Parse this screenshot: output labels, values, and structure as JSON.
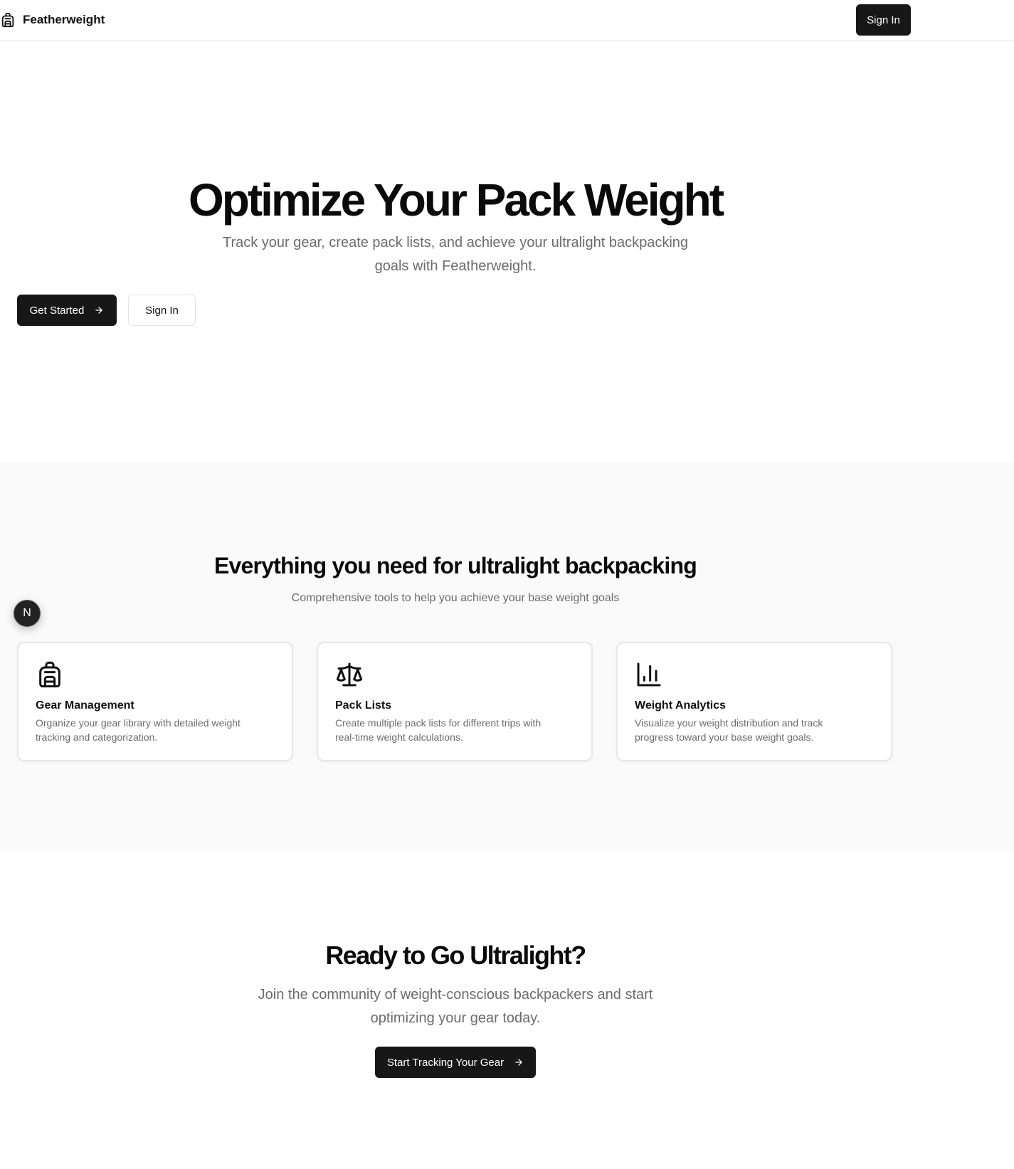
{
  "header": {
    "brand_name": "Featherweight",
    "brand_icon": "backpack-icon",
    "signin_label": "Sign In"
  },
  "hero": {
    "title": "Optimize Your Pack Weight",
    "subtitle": "Track your gear, create pack lists, and achieve your ultralight backpacking goals with Featherweight.",
    "primary_label": "Get Started",
    "secondary_label": "Sign In"
  },
  "features": {
    "title": "Everything you need for ultralight backpacking",
    "subtitle": "Comprehensive tools to help you achieve your base weight goals",
    "cards": [
      {
        "icon": "backpack-icon",
        "title": "Gear Management",
        "description": "Organize your gear library with detailed weight tracking and categorization."
      },
      {
        "icon": "scale-icon",
        "title": "Pack Lists",
        "description": "Create multiple pack lists for different trips with real-time weight calculations."
      },
      {
        "icon": "bar-chart-icon",
        "title": "Weight Analytics",
        "description": "Visualize your weight distribution and track progress toward your base weight goals."
      }
    ]
  },
  "badge": {
    "letter": "N"
  },
  "cta": {
    "title": "Ready to Go Ultralight?",
    "subtitle": "Join the community of weight-conscious backpackers and start optimizing your gear today.",
    "button_label": "Start Tracking Your Gear"
  },
  "colors": {
    "primary": "#171717",
    "muted_text": "#6b6b6b",
    "section_bg": "#fafafa",
    "border": "#e7e7e7"
  }
}
